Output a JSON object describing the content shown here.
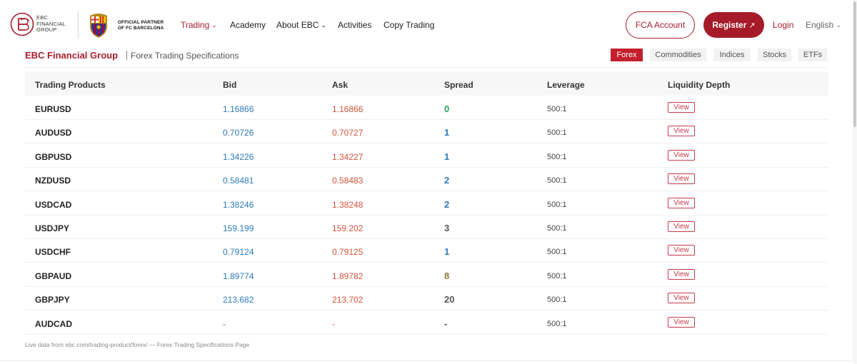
{
  "nav": {
    "logo_text": [
      "EBC",
      "FINANCIAL",
      "GROUP"
    ],
    "partner_text": [
      "OFFICIAL PARTNER",
      "OF FC BARCELONA"
    ],
    "menu": [
      "Trading",
      "Academy",
      "About EBC",
      "Activities",
      "Copy Trading"
    ],
    "fca_label": "FCA Account",
    "register_label": "Register",
    "login_label": "Login",
    "language": "English",
    "brand_color": "#a91d2e"
  },
  "subheader": {
    "brand": "EBC Financial Group",
    "title": "Forex Trading Specifications",
    "tabs": [
      "Forex",
      "Commodities",
      "Indices",
      "Stocks",
      "ETFs"
    ],
    "active_tab": "Forex"
  },
  "table": {
    "headers": [
      "Trading Products",
      "Bid",
      "Ask",
      "Spread",
      "Leverage",
      "Liquidity Depth"
    ],
    "view_label": "View",
    "rows": [
      {
        "symbol": "EURUSD",
        "bid": "1.16866",
        "ask": "1.16866",
        "spread": "0",
        "spread_color": "#27a65a",
        "leverage": "500:1"
      },
      {
        "symbol": "AUDUSD",
        "bid": "0.70726",
        "ask": "0.70727",
        "spread": "1",
        "spread_color": "#2d7ab8",
        "leverage": "500:1"
      },
      {
        "symbol": "GBPUSD",
        "bid": "1.34226",
        "ask": "1.34227",
        "spread": "1",
        "spread_color": "#2d7ab8",
        "leverage": "500:1"
      },
      {
        "symbol": "NZDUSD",
        "bid": "0.58481",
        "ask": "0.58483",
        "spread": "2",
        "spread_color": "#2d7ab8",
        "leverage": "500:1"
      },
      {
        "symbol": "USDCAD",
        "bid": "1.38246",
        "ask": "1.38248",
        "spread": "2",
        "spread_color": "#2d7ab8",
        "leverage": "500:1"
      },
      {
        "symbol": "USDJPY",
        "bid": "159.199",
        "ask": "159.202",
        "spread": "3",
        "spread_color": "#555555",
        "leverage": "500:1"
      },
      {
        "symbol": "USDCHF",
        "bid": "0.79124",
        "ask": "0.79125",
        "spread": "1",
        "spread_color": "#2d7ab8",
        "leverage": "500:1"
      },
      {
        "symbol": "GBPAUD",
        "bid": "1.89774",
        "ask": "1.89782",
        "spread": "8",
        "spread_color": "#8a7a3a",
        "leverage": "500:1"
      },
      {
        "symbol": "GBPJPY",
        "bid": "213.682",
        "ask": "213.702",
        "spread": "20",
        "spread_color": "#555555",
        "leverage": "500:1"
      },
      {
        "symbol": "AUDCAD",
        "bid": "-",
        "ask": "-",
        "spread": "-",
        "spread_color": "#555555",
        "leverage": "500:1"
      }
    ]
  },
  "footnote": "Live data from ebc.com/trading-product/forex/ — Forex Trading Specifications Page"
}
